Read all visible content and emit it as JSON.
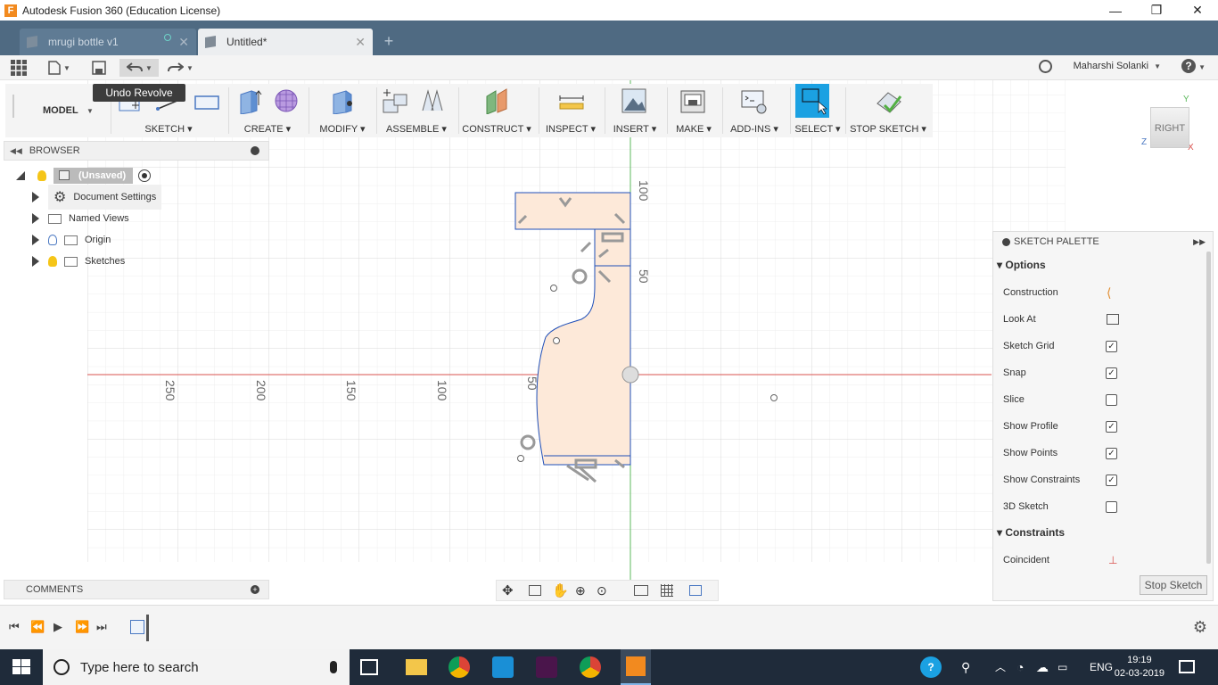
{
  "window": {
    "title": "Autodesk Fusion 360 (Education License)",
    "minimize": "—",
    "maximize": "❐",
    "close": "✕"
  },
  "tabs": [
    {
      "label": "mrugi bottle v1",
      "close": "✕"
    },
    {
      "label": "Untitled*",
      "close": "✕"
    }
  ],
  "new_tab": "+",
  "qat": {
    "user": "Maharshi Solanki",
    "help": "?"
  },
  "toolbar": {
    "workspace": "MODEL",
    "groups": [
      "SKETCH",
      "CREATE",
      "MODIFY",
      "ASSEMBLE",
      "CONSTRUCT",
      "INSPECT",
      "INSERT",
      "MAKE",
      "ADD-INS",
      "SELECT",
      "STOP SKETCH"
    ]
  },
  "tooltip": "Undo Revolve",
  "browser": {
    "title": "BROWSER",
    "root": "(Unsaved)",
    "items": [
      "Document Settings",
      "Named Views",
      "Origin",
      "Sketches"
    ]
  },
  "comments": {
    "title": "COMMENTS"
  },
  "viewcube": {
    "face": "RIGHT",
    "axis_y": "Y",
    "axis_z": "Z",
    "axis_x": "X"
  },
  "canvas": {
    "ruler_v": [
      "100",
      "50"
    ],
    "ruler_h": [
      "250",
      "200",
      "150",
      "100",
      "50"
    ]
  },
  "palette": {
    "title": "SKETCH PALETTE",
    "options_label": "Options",
    "options": [
      {
        "label": "Construction",
        "state": "icon"
      },
      {
        "label": "Look At",
        "state": "icon"
      },
      {
        "label": "Sketch Grid",
        "state": "checked"
      },
      {
        "label": "Snap",
        "state": "checked"
      },
      {
        "label": "Slice",
        "state": "unchecked"
      },
      {
        "label": "Show Profile",
        "state": "checked"
      },
      {
        "label": "Show Points",
        "state": "checked"
      },
      {
        "label": "Show Constraints",
        "state": "checked"
      },
      {
        "label": "3D Sketch",
        "state": "unchecked"
      }
    ],
    "constraints_label": "Constraints",
    "constraints": [
      "Coincident"
    ],
    "stop_button": "Stop Sketch"
  },
  "taskbar": {
    "search_placeholder": "Type here to search",
    "lang": "ENG",
    "time": "19:19",
    "date": "02-03-2019"
  },
  "colors": {
    "accent_blue": "#1ba1e2",
    "profile_fill": "#fde9d9",
    "sketch_line": "#1f4fb8",
    "x_axis": "#d9534f",
    "y_axis": "#5cb85c",
    "tab_bar": "#4f6a82",
    "taskbar": "#1f2b3a"
  }
}
